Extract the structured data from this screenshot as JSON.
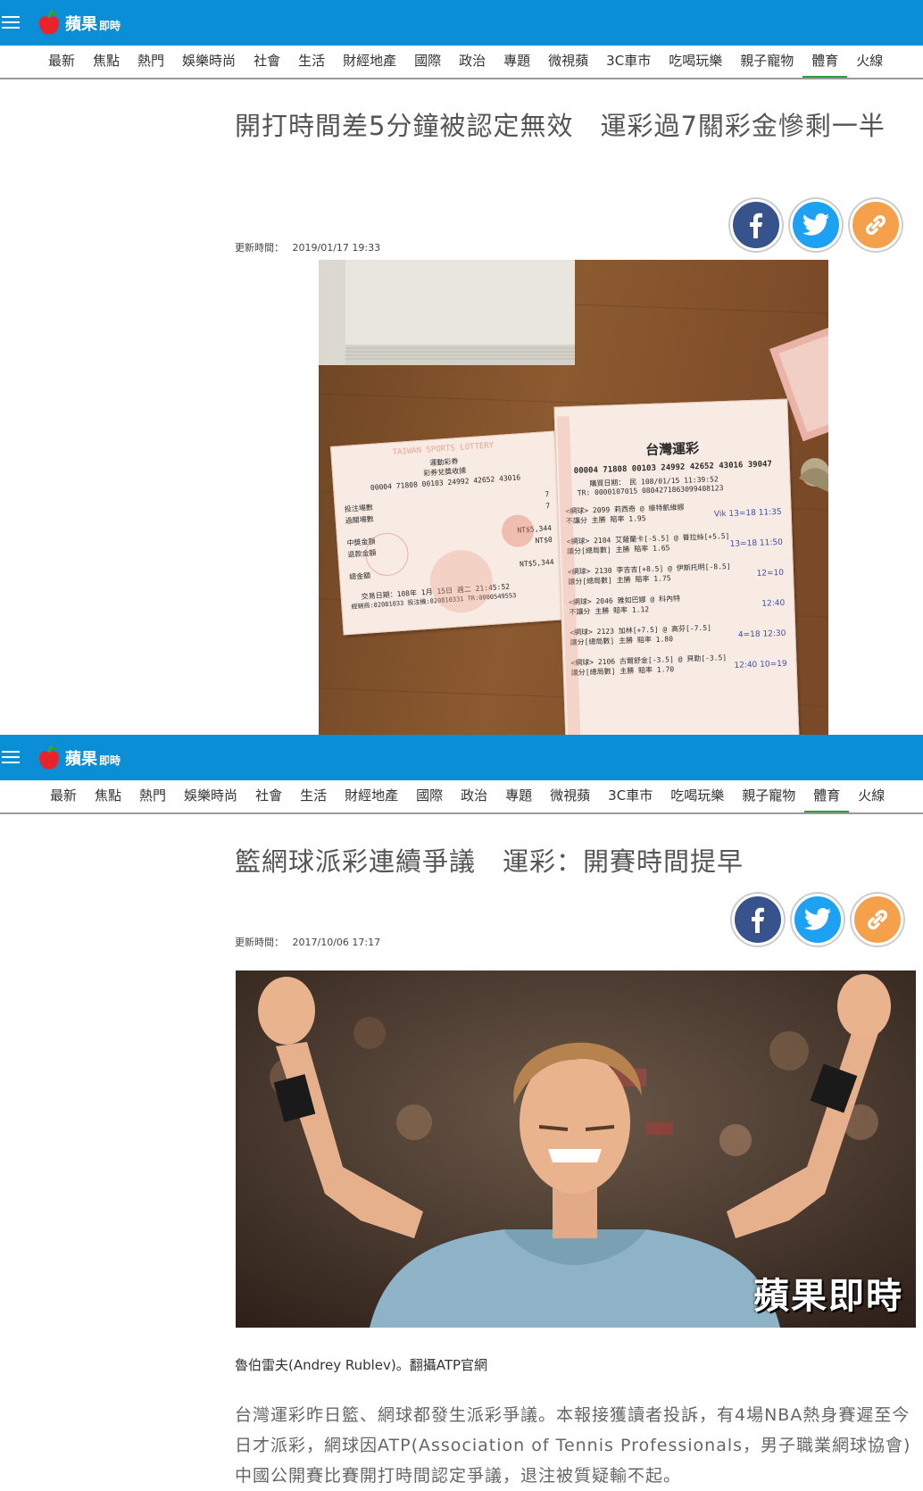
{
  "brand": {
    "name": "蘋果",
    "sub": "即時"
  },
  "nav": [
    "最新",
    "焦點",
    "熱門",
    "娛樂時尚",
    "社會",
    "生活",
    "財經地產",
    "國際",
    "政治",
    "專題",
    "微視蘋",
    "3C車市",
    "吃喝玩樂",
    "親子寵物",
    "體育",
    "火線"
  ],
  "nav_active": "體育",
  "colors": {
    "header": "#0a8fd6",
    "active_underline": "#2e9d3a",
    "facebook": "#36538c",
    "twitter": "#1da1f2",
    "link": "#f5a04a"
  },
  "share_icons": [
    "facebook-icon",
    "twitter-icon",
    "link-icon"
  ],
  "article1": {
    "title": "開打時間差5分鐘被認定無效　運彩過7關彩金慘剩一半",
    "updated_label": "更新時間：",
    "updated_value": "2019/01/17 19:33",
    "ticket_small": {
      "header": "TAIWAN SPORTS LOTTERY",
      "type": "運動彩券",
      "subtitle": "彩券兌獎收據",
      "serial": "00004 71808 00103 24992 42652 43016",
      "rows": [
        {
          "label": "投注場數",
          "value": "7"
        },
        {
          "label": "過關場數",
          "value": "7"
        },
        {
          "label": "中獎金額",
          "value": "NT$5,344"
        },
        {
          "label": "退款金額",
          "value": "NT$0"
        },
        {
          "label": "總金額",
          "value": "NT$5,344"
        }
      ],
      "trade": "交易日期：108年 1月 15日 週二 21:45:52",
      "agent": "經銷商:02081033 投注機:020810331 TR:0000549553"
    },
    "ticket_big": {
      "header": "台灣運彩",
      "serial": "00004 71808 00103 24992 42652 43016 39047",
      "buy_date": "購買日期： 民 108/01/15 11:39:52",
      "tr": "TR: 0000107015 0804271863099408123",
      "lines": [
        {
          "a": "<網球> 2099 莉西奇 @ 維特凱維娜",
          "b": "不讓分 主勝 賠率 1.95",
          "note": "Vik 13=18 11:35"
        },
        {
          "a": "<網球> 2104 艾薩蘭卡[-5.5] @ 普拉絲[+5.5]",
          "b": "讓分[總局數] 主勝 賠率 1.65",
          "note": "13=18 11:50"
        },
        {
          "a": "<網球> 2130 李吉吉[+8.5] @ 伊斯托明[-8.5]",
          "b": "讓分[總局數] 主勝 賠率 1.75",
          "note": "12=10"
        },
        {
          "a": "<網球> 2046 雅如巴娜 @ 科內特",
          "b": "不讓分 主勝 賠率 1.12",
          "note": "12:40"
        },
        {
          "a": "<網球> 2123 加林[+7.5] @ 高芬[-7.5]",
          "b": "讓分[總局數] 主勝 賠率 1.80",
          "note": "4=18 12:30"
        },
        {
          "a": "<網球> 2106 古爾舒金[-3.5] @ 貝勒[-3.5]",
          "b": "讓分[總局數] 主勝 賠率 1.70",
          "note": "12:40 10=19"
        }
      ]
    }
  },
  "article2": {
    "title": "籃網球派彩連續爭議　運彩：開賽時間提早",
    "updated_label": "更新時間：",
    "updated_value": "2017/10/06 17:17",
    "watermark": "蘋果即時",
    "caption": "魯伯雷夫(Andrey Rublev)。翻攝ATP官網",
    "body": "台灣運彩昨日籃、網球都發生派彩爭議。本報接獲讀者投訴，有4場NBA熱身賽遲至今日才派彩，網球因ATP(Association of Tennis Professionals，男子職業網球協會)中國公開賽比賽開打時間認定爭議，退注被質疑輸不起。"
  }
}
